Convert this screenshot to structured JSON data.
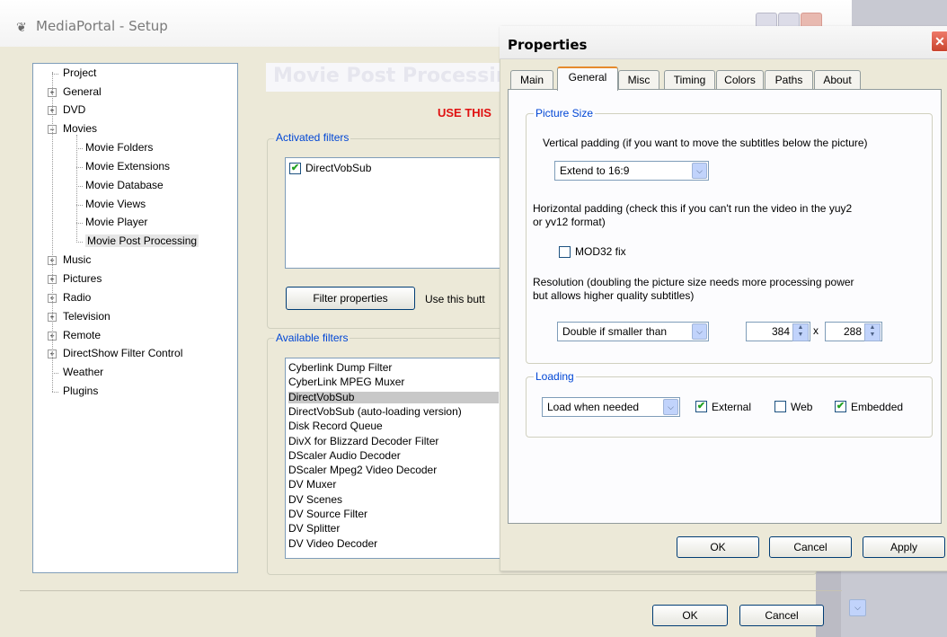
{
  "main_window": {
    "title": "MediaPortal - Setup",
    "logo_glyph": "❦",
    "page_heading": "Movie Post Processing",
    "use_this_text": "USE THIS",
    "activated_filters_label": "Activated filters",
    "activated_filters": [
      {
        "label": "DirectVobSub",
        "checked": true
      }
    ],
    "filter_properties_button": "Filter properties",
    "filter_hint": "Use this butt",
    "available_filters_label": "Available filters",
    "available_filters": [
      "Cyberlink Dump Filter",
      "CyberLink MPEG Muxer",
      "DirectVobSub",
      "DirectVobSub (auto-loading version)",
      "Disk Record Queue",
      "DivX for Blizzard Decoder Filter",
      "DScaler Audio Decoder",
      "DScaler Mpeg2 Video Decoder",
      "DV Muxer",
      "DV Scenes",
      "DV Source Filter",
      "DV Splitter",
      "DV Video Decoder"
    ],
    "selected_available_filter": "DirectVobSub",
    "ok_button": "OK",
    "cancel_button": "Cancel"
  },
  "tree": {
    "items": [
      {
        "label": "Project",
        "expander": ""
      },
      {
        "label": "General",
        "expander": "+"
      },
      {
        "label": "DVD",
        "expander": "+"
      },
      {
        "label": "Movies",
        "expander": "−"
      },
      {
        "label": "Movie Folders",
        "expander": ""
      },
      {
        "label": "Movie Extensions",
        "expander": ""
      },
      {
        "label": "Movie Database",
        "expander": ""
      },
      {
        "label": "Movie Views",
        "expander": ""
      },
      {
        "label": "Movie Player",
        "expander": ""
      },
      {
        "label": "Movie Post Processing",
        "expander": "",
        "selected": true
      },
      {
        "label": "Music",
        "expander": "+"
      },
      {
        "label": "Pictures",
        "expander": "+"
      },
      {
        "label": "Radio",
        "expander": "+"
      },
      {
        "label": "Television",
        "expander": "+"
      },
      {
        "label": "Remote",
        "expander": "+"
      },
      {
        "label": "DirectShow Filter Control",
        "expander": "+"
      },
      {
        "label": "Weather",
        "expander": ""
      },
      {
        "label": "Plugins",
        "expander": ""
      }
    ]
  },
  "properties": {
    "title": "Properties",
    "close_glyph": "✕",
    "tabs": [
      "Main",
      "General",
      "Misc",
      "Timing",
      "Colors",
      "Paths",
      "About"
    ],
    "active_tab": "General",
    "picture_size_label": "Picture Size",
    "vertical_padding_text": "Vertical padding (if you want to move the subtitles below the picture)",
    "vertical_padding_value": "Extend to 16:9",
    "horizontal_padding_line1": "Horizontal padding (check this if you can't run the video in the yuy2",
    "horizontal_padding_line2": "or yv12 format)",
    "mod32_label": "MOD32 fix",
    "mod32_checked": false,
    "resolution_line1": "Resolution (doubling the picture size needs more processing power",
    "resolution_line2": "but allows higher quality subtitles)",
    "resolution_mode": "Double if smaller than",
    "resolution_width": "384",
    "resolution_x": "x",
    "resolution_height": "288",
    "loading_label": "Loading",
    "loading_mode": "Load when needed",
    "external_label": "External",
    "external_checked": true,
    "web_label": "Web",
    "web_checked": false,
    "embedded_label": "Embedded",
    "embedded_checked": true,
    "ok_button": "OK",
    "cancel_button": "Cancel",
    "apply_button": "Apply"
  },
  "icons": {
    "checkmark": "✔",
    "chevron_down": "⌵",
    "spin_up": "▲",
    "spin_down": "▼"
  },
  "colors": {
    "group_label_blue": "#0046d5",
    "warning_red": "#e01010",
    "active_tab_accent": "#e68b2c"
  }
}
